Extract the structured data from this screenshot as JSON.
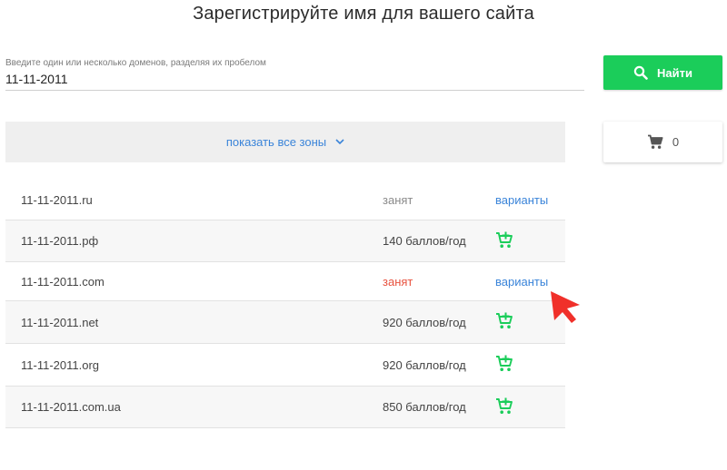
{
  "header": {
    "title": "Зарегистрируйте имя для вашего сайта"
  },
  "search": {
    "label": "Введите один или несколько доменов, разделяя их пробелом",
    "value": "11-11-2011",
    "button_label": "Найти",
    "icon": "search-icon"
  },
  "zones": {
    "link_label": "показать все зоны",
    "icon": "chevron-down-icon"
  },
  "cart": {
    "count": "0",
    "icon": "cart-icon"
  },
  "results": [
    {
      "domain": "11-11-2011.ru",
      "price": "занят",
      "status": "taken",
      "status_color": "#8a8a8a",
      "action": "variants",
      "action_label": "варианты"
    },
    {
      "domain": "11-11-2011.рф",
      "price": "140 баллов/год",
      "status": "available",
      "action": "add-to-cart"
    },
    {
      "domain": "11-11-2011.com",
      "price": "занят",
      "status": "taken",
      "status_color": "#e8523f",
      "action": "variants",
      "action_label": "варианты"
    },
    {
      "domain": "11-11-2011.net",
      "price": "920 баллов/год",
      "status": "available",
      "action": "add-to-cart"
    },
    {
      "domain": "11-11-2011.org",
      "price": "920 баллов/год",
      "status": "available",
      "action": "add-to-cart"
    },
    {
      "domain": "11-11-2011.com.ua",
      "price": "850 баллов/год",
      "status": "available",
      "action": "add-to-cart"
    }
  ],
  "colors": {
    "accent_green": "#1bcd5a",
    "link_blue": "#3a84d9",
    "taken_red": "#e8523f",
    "pointer_red": "#f0302a"
  }
}
